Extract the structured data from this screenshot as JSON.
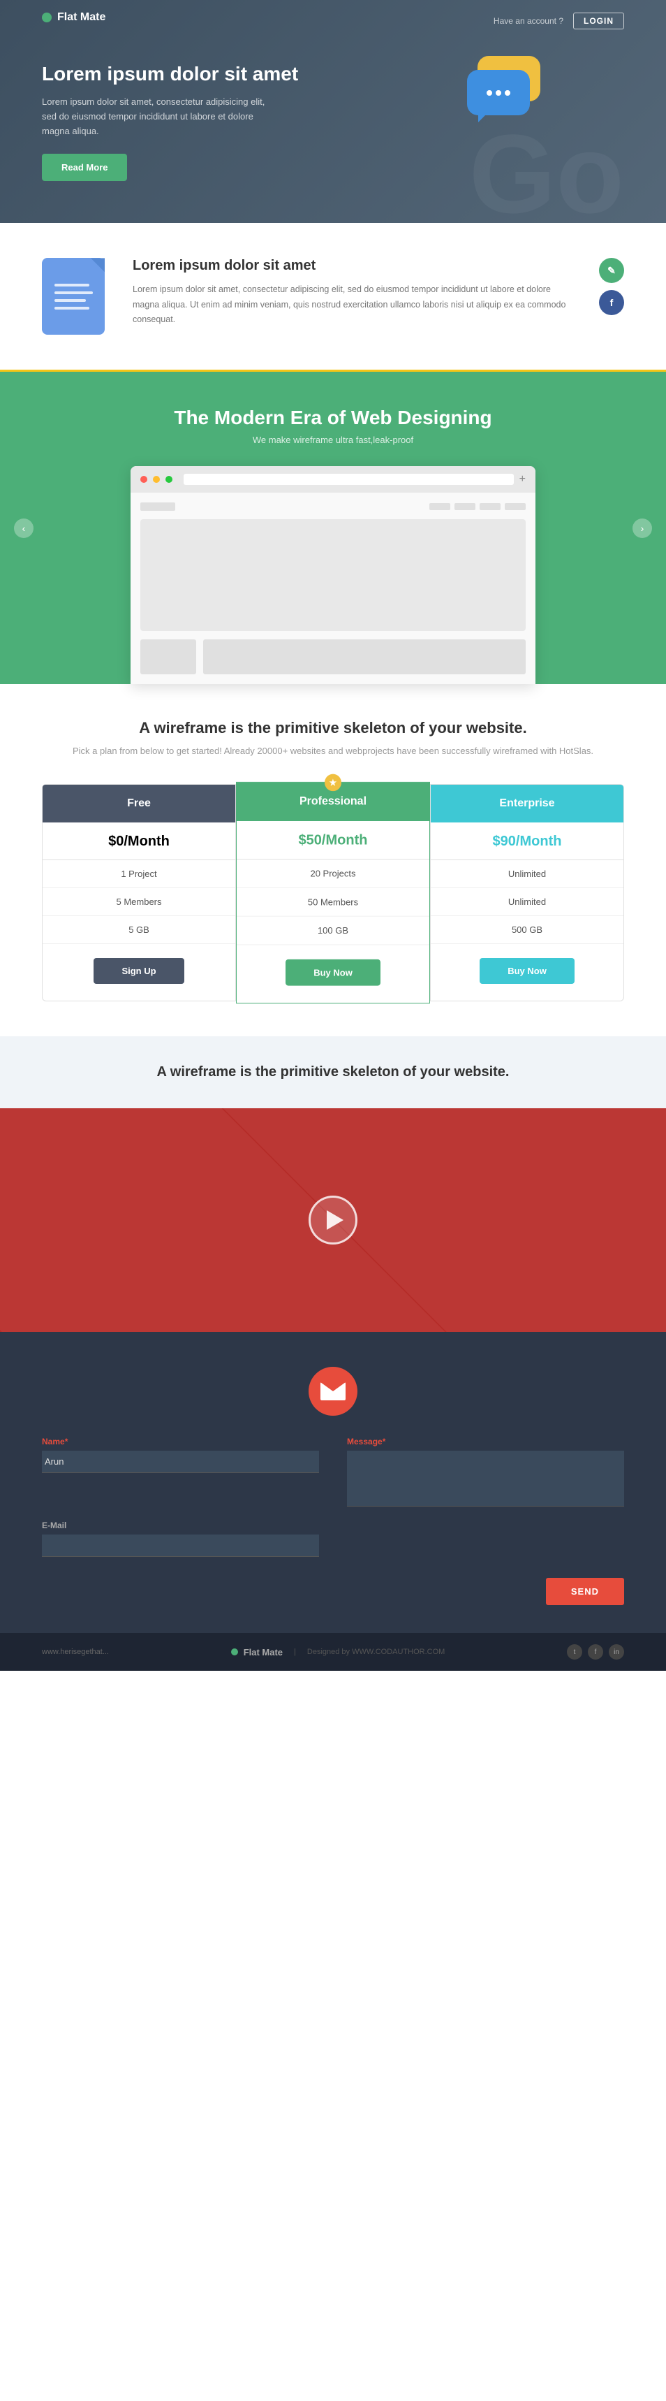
{
  "navbar": {
    "logo": "Flat Mate",
    "account_text": "Have an account ?",
    "login_label": "LOGIN"
  },
  "hero": {
    "title": "Lorem ipsum dolor sit amet",
    "description": "Lorem ipsum dolor sit amet, consectetur adipisicing elit, sed do eiusmod tempor incididunt ut labore et dolore magna aliqua.",
    "cta_label": "Read More",
    "bg_text": "Go"
  },
  "feature": {
    "title": "Lorem ipsum dolor sit amet",
    "description": "Lorem ipsum dolor sit amet, consectetur adipiscing elit, sed do eiusmod tempor incididunt ut labore et dolore magna aliqua. Ut enim ad minim veniam, quis nostrud exercitation ullamco laboris nisi ut aliquip ex ea commodo consequat.",
    "edit_icon": "✎",
    "fb_icon": "f"
  },
  "wireframe": {
    "title": "The Modern Era of Web Designing",
    "subtitle": "We make wireframe ultra fast,leak-proof"
  },
  "pricing": {
    "title": "A wireframe is the primitive skeleton of your website.",
    "subtitle": "Pick a plan from below to get started! Already 20000+ websites and webprojects\nhave been successfully wireframed with HotSlas.",
    "plans": [
      {
        "name": "Free",
        "price": "$0/Month",
        "features": [
          "1 Project",
          "5 Members",
          "5 GB"
        ],
        "btn_label": "Sign Up",
        "btn_type": "dark"
      },
      {
        "name": "Professional",
        "price": "$50/Month",
        "features": [
          "20 Projects",
          "50 Members",
          "100 GB"
        ],
        "btn_label": "Buy Now",
        "btn_type": "green",
        "featured": true
      },
      {
        "name": "Enterprise",
        "price": "$90/Month",
        "features": [
          "Unlimited",
          "Unlimited",
          "500 GB"
        ],
        "btn_label": "Buy Now",
        "btn_type": "cyan"
      }
    ]
  },
  "testimonial": {
    "text": "A wireframe is the primitive skeleton of your website."
  },
  "contact": {
    "name_label": "Name",
    "name_required": "*",
    "name_value": "Arun",
    "email_label": "E-Mail",
    "email_value": "",
    "message_label": "Message",
    "message_required": "*",
    "message_value": "",
    "send_label": "SEND"
  },
  "footer": {
    "left_text": "www.herisegethat...",
    "logo": "Flat Mate",
    "right_text": "Designed by WWW.CODAUTHOR.COM",
    "social": [
      "t",
      "f",
      "in"
    ]
  }
}
